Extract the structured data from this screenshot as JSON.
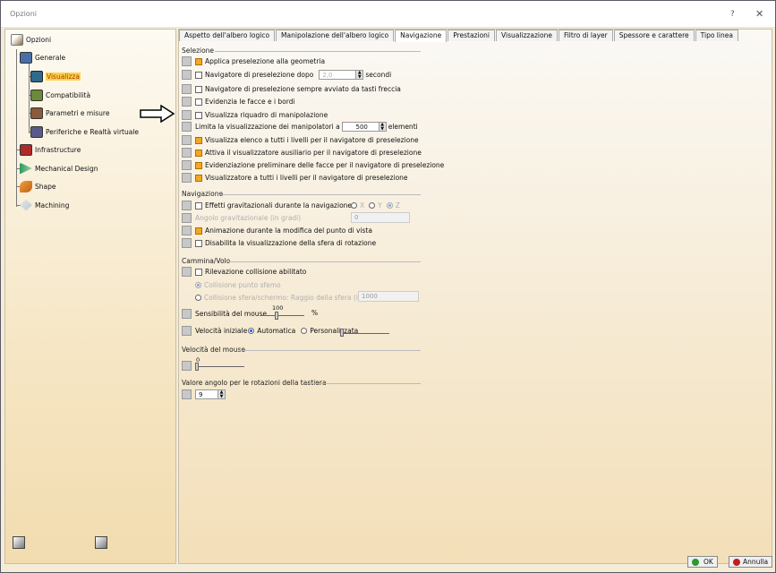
{
  "window": {
    "title": "Opzioni",
    "help": "?",
    "close": "✕"
  },
  "tree": {
    "root": "Opzioni",
    "generale": "Generale",
    "visualizza": "Visualizza",
    "compatibilita": "Compatibilità",
    "parametri": "Parametri e misure",
    "periferiche": "Periferiche e Realtà virtuale",
    "infrastructure": "Infrastructure",
    "mechanical": "Mechanical Design",
    "shape": "Shape",
    "machining": "Machining"
  },
  "tabs": [
    "Aspetto dell'albero logico",
    "Manipolazione dell'albero logico",
    "Navigazione",
    "Prestazioni",
    "Visualizzazione",
    "Filtro di layer",
    "Spessore e carattere",
    "Tipo linea"
  ],
  "active_tab": "Navigazione",
  "selezione": {
    "title": "Selezione",
    "items": [
      "Applica preselezione alla geometria",
      "Navigatore di preselezione dopo",
      "Navigatore di preselezione sempre avviato da tasti freccia",
      "Evidenzia le facce e i bordi",
      "Visualizza riquadro di manipolazione",
      "Limita la visualizzazione dei manipolatori a",
      "Visualizza elenco a tutti i livelli per il navigatore di preselezione",
      "Attiva il visualizzatore ausiliario per il navigatore di preselezione",
      "Evidenziazione preliminare delle facce per il navigatore di preselezione",
      "Visualizzatore a tutti i livelli per il navigatore di preselezione"
    ],
    "delay_value": "2,0",
    "delay_unit": "secondi",
    "manip_value": "500",
    "manip_unit": "elementi"
  },
  "navigazione": {
    "title": "Navigazione",
    "items": [
      "Effetti gravitazionali durante la navigazione",
      "Angolo gravitazionale (in gradi)",
      "Animazione durante la modifica del punto di vista",
      "Disabilita la visualizzazione della sfera di rotazione"
    ],
    "axes": [
      "X",
      "Y",
      "Z"
    ],
    "angle_value": "0"
  },
  "cammina": {
    "title": "Cammina/Volo",
    "collision": "Rilevazione collisione abilitato",
    "opt1": "Collisione punto sfemo",
    "opt2": "Collisione sfera/schermo: Raggio della sfera (in mm)",
    "radius_value": "1000",
    "sens_label": "Sensibilità del mouse",
    "sens_value": "100",
    "sens_unit": "%",
    "vel_label": "Velocità iniziale",
    "vel_auto": "Automatica",
    "vel_custom": "Personalizzata"
  },
  "mouse_speed": {
    "title": "Velocità del mouse",
    "value": "0"
  },
  "keyboard_angle": {
    "title": "Valore angolo per le rotazioni della tastiera",
    "value": "9"
  },
  "buttons": {
    "ok": "OK",
    "cancel": "Annulla"
  }
}
